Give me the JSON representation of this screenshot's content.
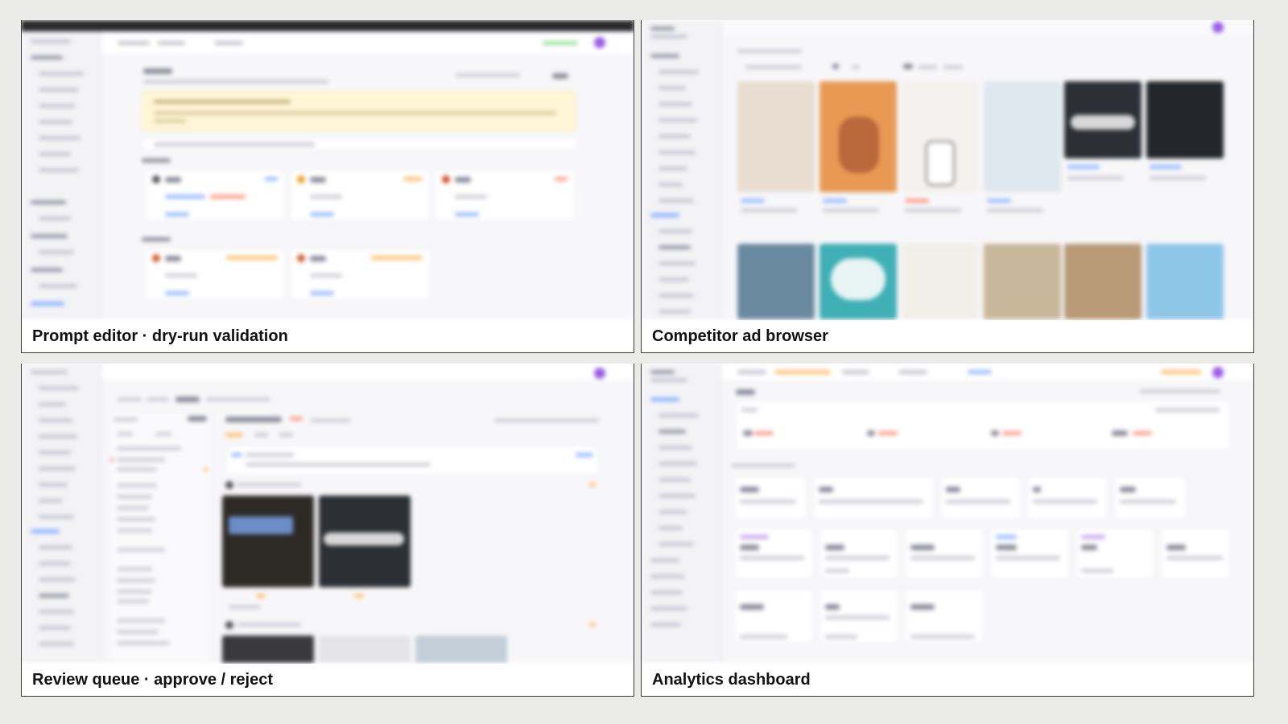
{
  "panels": [
    {
      "id": "prompt-editor",
      "caption": "Prompt editor · dry-run validation"
    },
    {
      "id": "competitor-ad-browser",
      "caption": "Competitor ad browser"
    },
    {
      "id": "review-queue",
      "caption": "Review queue · approve / reject"
    },
    {
      "id": "analytics-dashboard",
      "caption": "Analytics dashboard"
    }
  ],
  "colors": {
    "background": "#ebebea",
    "accent": "#9b5de5",
    "warning_banner": "#fff6d6",
    "link_blue": "#8fb3ff"
  }
}
